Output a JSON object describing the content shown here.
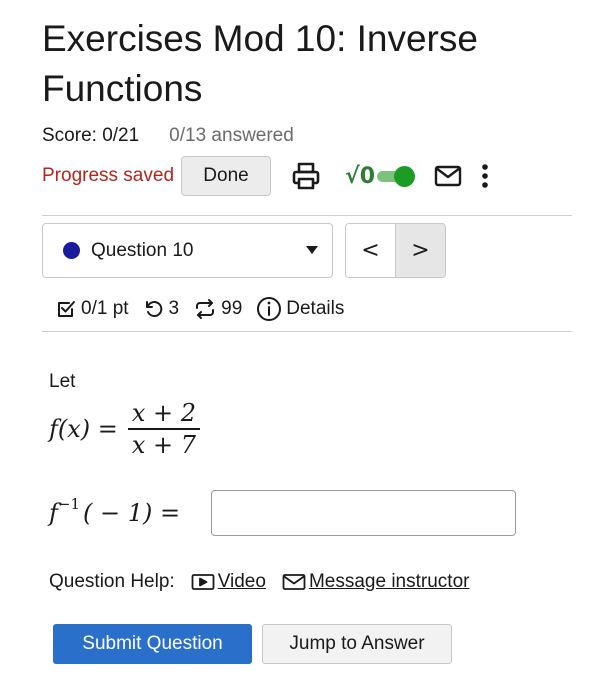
{
  "header": {
    "title": "Exercises Mod 10: Inverse Functions",
    "score": "Score: 0/21",
    "answered": "0/13 answered"
  },
  "toolbar": {
    "progress_status": "Progress saved",
    "done_label": "Done",
    "icons": [
      "print-icon",
      "sqrt-math-toggle-icon",
      "mail-icon",
      "more-vertical-icon"
    ],
    "sqrt_glyph": "√0",
    "math_toggle_on": true,
    "accent_green": "#1b9c24"
  },
  "question_nav": {
    "selected": "Question 10",
    "status_dot_color": "#1a1a9c",
    "prev_glyph": "<",
    "next_glyph": ">"
  },
  "question_meta": {
    "points": "0/1 pt",
    "retries": "3",
    "attempts": "99",
    "details_label": "Details"
  },
  "problem": {
    "intro": "Let",
    "function_lhs": "f(x) =",
    "numerator": "x + 2",
    "denominator": "x + 7",
    "inverse_base": "f",
    "inverse_exponent": "−1",
    "inverse_arg": "( − 1) =",
    "answer_value": ""
  },
  "help": {
    "label": "Question Help:",
    "video_label": "Video",
    "message_label": "Message instructor"
  },
  "actions": {
    "submit_label": "Submit Question",
    "jump_label": "Jump to Answer",
    "submit_color": "#2a6fc9"
  }
}
